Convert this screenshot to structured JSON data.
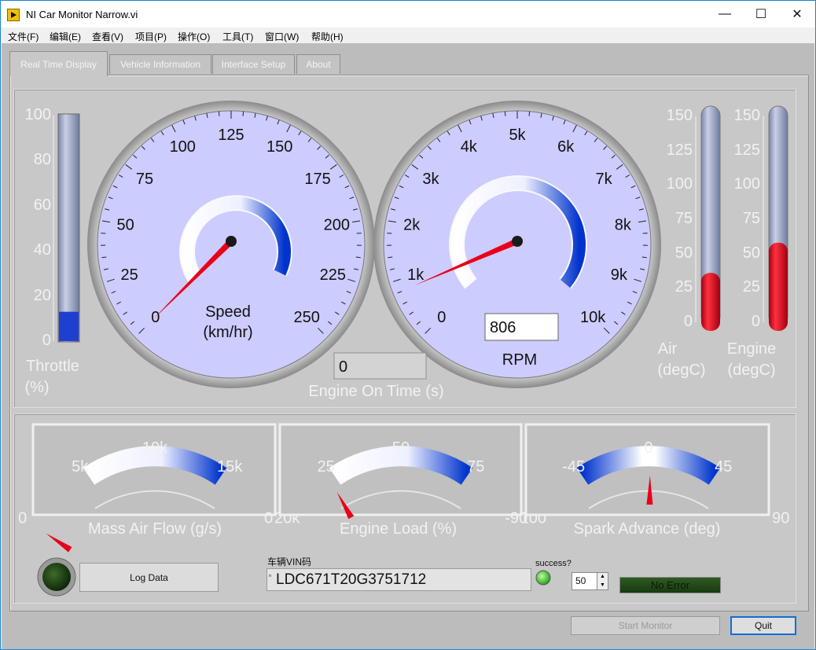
{
  "window": {
    "title": "NI Car Monitor Narrow.vi",
    "controls": {
      "minimize": "—",
      "maximize": "☐",
      "close": "✕"
    }
  },
  "menu": [
    "文件(F)",
    "编辑(E)",
    "查看(V)",
    "项目(P)",
    "操作(O)",
    "工具(T)",
    "窗口(W)",
    "帮助(H)"
  ],
  "tabs": [
    "Real Time Display",
    "Vehicle Information",
    "Interface Setup",
    "About"
  ],
  "throttle": {
    "ticks": [
      "100",
      "80",
      "60",
      "40",
      "20",
      "0"
    ],
    "value_percent": 13,
    "label_line1": "Throttle",
    "label_line2": "(%)"
  },
  "speed": {
    "ticks": [
      "0",
      "25",
      "50",
      "75",
      "100",
      "125",
      "150",
      "175",
      "200",
      "225",
      "250"
    ],
    "value": 0,
    "label_line1": "Speed",
    "label_line2": "(km/hr)"
  },
  "rpm": {
    "ticks": [
      "0",
      "1k",
      "2k",
      "3k",
      "4k",
      "5k",
      "6k",
      "7k",
      "8k",
      "9k",
      "10k"
    ],
    "value": 806,
    "display": "806",
    "label": "RPM"
  },
  "engine_on_time": {
    "value": "0",
    "label": "Engine On Time (s)"
  },
  "air_temp": {
    "ticks": [
      "150",
      "125",
      "100",
      "75",
      "50",
      "25",
      "0"
    ],
    "value": 36,
    "label_line1": "Air",
    "label_line2": "(degC)"
  },
  "engine_temp": {
    "ticks": [
      "150",
      "125",
      "100",
      "75",
      "50",
      "25",
      "0"
    ],
    "value": 58,
    "label_line1": "Engine",
    "label_line2": "(degC)"
  },
  "mass_air_flow": {
    "ticks": [
      "0",
      "5k",
      "10k",
      "15k",
      "20k"
    ],
    "value": 0,
    "label": "Mass Air Flow (g/s)"
  },
  "engine_load": {
    "ticks": [
      "0",
      "25",
      "50",
      "75",
      "100"
    ],
    "value": 24,
    "label": "Engine Load (%)"
  },
  "spark_advance": {
    "ticks": [
      "-90",
      "-45",
      "0",
      "45",
      "90"
    ],
    "value": 1,
    "label": "Spark Advance (deg)"
  },
  "log_button": "Log Data",
  "vin": {
    "label": "车辆VIN码",
    "prefix": "ⁿ",
    "value": "LDC671T20G3751712"
  },
  "success": {
    "label": "success?",
    "interval": "50"
  },
  "error_status": "No Error",
  "buttons": {
    "start": "Start Monitor",
    "quit": "Quit"
  },
  "colors": {
    "dial_face": "#ccccff",
    "gauge_blue": "#0037d0",
    "needle": "#e8001a",
    "tank_fill": "#2040c8",
    "thermo_fill": "#e00010",
    "led_green": "#33cc33",
    "led_dark": "#1a3a10"
  }
}
